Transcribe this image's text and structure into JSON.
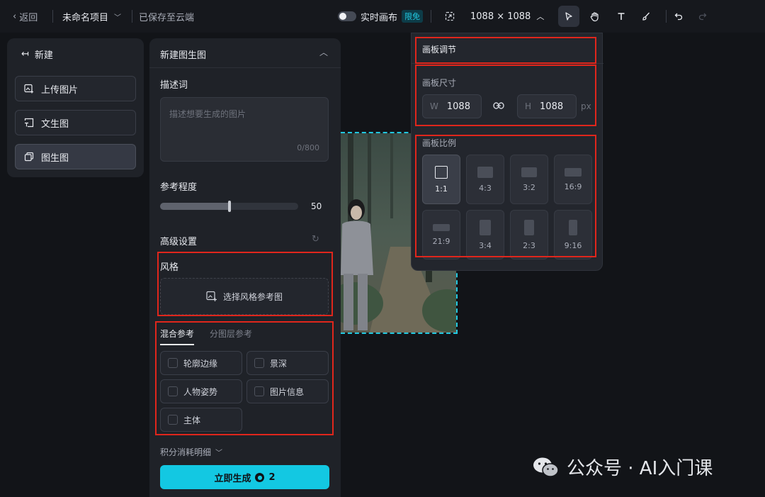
{
  "topbar": {
    "back_label": "返回",
    "project_name": "未命名项目",
    "save_status": "已保存至云端",
    "realtime_label": "实时画布",
    "realtime_badge": "限免",
    "canvas_size": "1088 × 1088"
  },
  "leftnav": {
    "new_label": "新建",
    "items": [
      {
        "label": "上传图片"
      },
      {
        "label": "文生图"
      },
      {
        "label": "图生图",
        "active": true
      }
    ]
  },
  "form": {
    "title": "新建图生图",
    "description_label": "描述词",
    "description_placeholder": "描述想要生成的图片",
    "description_count": "0/800",
    "reference_label": "参考程度",
    "reference_value": 50,
    "advanced_label": "高级设置",
    "style_label": "风格",
    "style_button": "选择风格参考图",
    "tabs": [
      {
        "label": "混合参考",
        "active": true
      },
      {
        "label": "分图层参考",
        "active": false
      }
    ],
    "options": [
      {
        "label": "轮廓边缘",
        "checked": false
      },
      {
        "label": "景深",
        "checked": false
      },
      {
        "label": "人物姿势",
        "checked": false
      },
      {
        "label": "图片信息",
        "checked": false
      },
      {
        "label": "主体",
        "checked": false
      }
    ],
    "points_label": "积分消耗明细",
    "generate_label": "立即生成",
    "generate_cost": "2"
  },
  "popover": {
    "title": "画板调节",
    "size_label": "画板尺寸",
    "width_prefix": "W",
    "width_value": "1088",
    "height_prefix": "H",
    "height_value": "1088",
    "unit": "px",
    "ratio_label": "画板比例",
    "ratios": [
      {
        "label": "1:1",
        "active": true
      },
      {
        "label": "4:3"
      },
      {
        "label": "3:2"
      },
      {
        "label": "16:9"
      },
      {
        "label": "21:9"
      },
      {
        "label": "3:4"
      },
      {
        "label": "2:3"
      },
      {
        "label": "9:16"
      }
    ]
  },
  "watermark": "公众号 · AI入门课",
  "colors": {
    "accent": "#13c8e2",
    "highlight": "#e0261c",
    "background": "#121418",
    "panel": "#1f2228"
  }
}
